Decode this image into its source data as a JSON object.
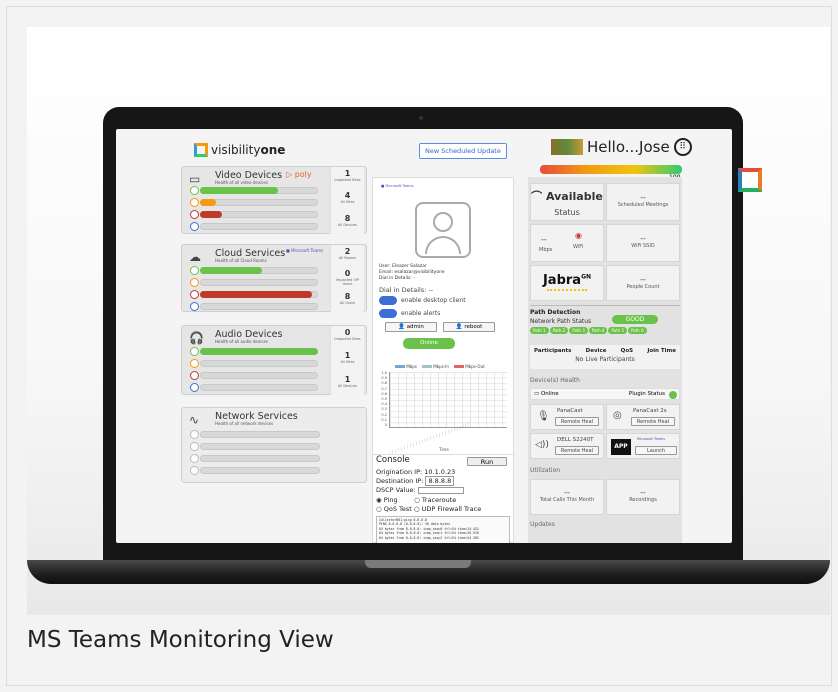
{
  "caption": "MS Teams Monitoring View",
  "app": {
    "logo_text_a": "visibility",
    "logo_text_b": "one",
    "schedule_button": "New Scheduled Update",
    "greeting": "Hello...Jose",
    "health_value": "100"
  },
  "services": [
    {
      "title": "Video Devices",
      "subtitle": "Health of all video devices",
      "brand": "poly",
      "counts": [
        {
          "n": "1",
          "l": "Impacted Sites"
        },
        {
          "n": "4",
          "l": "All Sites"
        },
        {
          "n": "8",
          "l": "All Devices"
        }
      ]
    },
    {
      "title": "Cloud Services",
      "subtitle": "Health of all Cloud Rooms",
      "brand": "Microsoft Teams",
      "counts": [
        {
          "n": "2",
          "l": "All Rooms"
        },
        {
          "n": "0",
          "l": "Impacted VIP Users"
        },
        {
          "n": "8",
          "l": "All Users"
        }
      ]
    },
    {
      "title": "Audio Devices",
      "subtitle": "Health of all audio devices",
      "brand": "",
      "counts": [
        {
          "n": "0",
          "l": "Impacted Sites"
        },
        {
          "n": "1",
          "l": "All Sites"
        },
        {
          "n": "1",
          "l": "All Devices"
        }
      ]
    },
    {
      "title": "Network Services",
      "subtitle": "Health of all network devices",
      "brand": "",
      "counts": []
    }
  ],
  "user": {
    "teams_label": "Microsoft Teams",
    "user_line": "User: Eleazer Salazar",
    "email_line": "Email: esalazar@visibilityone",
    "dial_line": "Dial in Details: -",
    "dial_in": "Dial in Details: --",
    "toggle_desktop": "enable desktop client",
    "toggle_alerts": "enable alerts",
    "admin": "admin",
    "reboot": "reboot",
    "status_button": "Online"
  },
  "mini_chart": {
    "legend": [
      "Mbps",
      "Mbps-In",
      "Mbps-Out"
    ],
    "y_ticks": [
      "1.0",
      "0.9",
      "0.8",
      "0.7",
      "0.6",
      "0.5",
      "0.4",
      "0.3",
      "0.2",
      "0.1",
      "0"
    ],
    "xlabel": "Time"
  },
  "console": {
    "title": "Console",
    "run": "Run",
    "origination_label": "Origination IP:",
    "origination_value": "10.1.0.23",
    "destination_label": "Destination IP:",
    "destination_value": "8.8.8.8",
    "dscp_label": "DSCP Value:",
    "opt_ping": "Ping",
    "opt_traceroute": "Traceroute",
    "opt_qos": "QoS Test",
    "opt_udp": "UDP Firewall Trace",
    "output": [
      "CollectorB01:ping 8.8.8.8",
      "PING 8.8.8.8 (8.8.8.8): 56 data bytes",
      "64 bytes from 8.8.8.8: icmp_seq=0 ttl=54 time=24.452",
      "64 bytes from 8.8.8.8: icmp_seq=1 ttl=54 time=26.916",
      "64 bytes from 8.8.8.8: icmp_seq=2 ttl=54 time=24.365"
    ]
  },
  "status": {
    "available": "Available",
    "status_label": "Status",
    "meetings_value": "--",
    "meetings_label": "Scheduled Meetings",
    "mbps_value": "--",
    "mbps_label": "Mbps",
    "wifi_label": "WiFi",
    "ssid_value": "--",
    "ssid_label": "WiFi SSID",
    "jabra": "Jabra",
    "jabra_sup": "GN",
    "people_value": "--",
    "people_label": "People Count"
  },
  "path": {
    "title": "Path Detection",
    "status_label": "Network Path Status",
    "status_value": "GOOD",
    "paths": [
      "Path 1",
      "Path 2",
      "Path 3",
      "Path 4",
      "Path 5",
      "Path 6"
    ],
    "cols": [
      "Participants",
      "Device",
      "QoS",
      "Join Time"
    ],
    "empty": "No Live Participants"
  },
  "devices": {
    "title": "Device(s) Health",
    "online": "Online",
    "plugin": "Plugin Status",
    "d1_name": "PanaCast",
    "d1_action": "Remote Heal",
    "d2_name": "PanaCast 2s",
    "d2_action": "Remote Heal",
    "d3_name": "DELL S2240T",
    "d3_action": "Remote Heal",
    "app": "APP",
    "app_brand": "Microsoft Teams",
    "app_action": "Launch"
  },
  "utilization": {
    "title": "Utilization",
    "calls_value": "--",
    "calls_label": "Total Calls This Month",
    "rec_value": "--",
    "rec_label": "Recordings",
    "updates": "Updates"
  },
  "colors": {
    "green": "#6bc24a",
    "orange": "#f39c12",
    "red": "#c0392b",
    "blue": "#3b6fd6",
    "accent": "#5b8de0"
  }
}
